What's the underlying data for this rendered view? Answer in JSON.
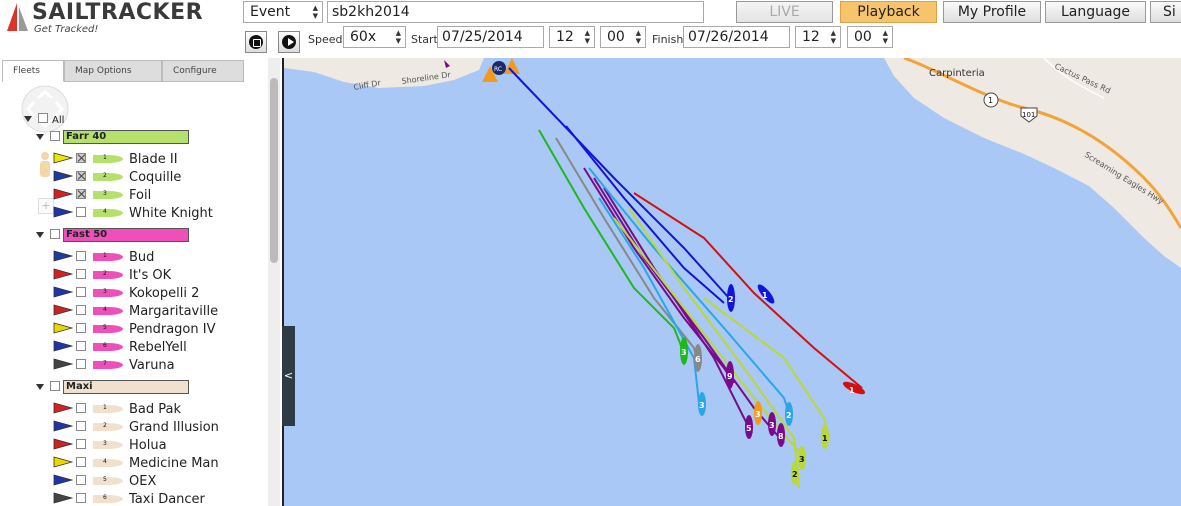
{
  "app": {
    "logo_title": "SAILTRACKER",
    "logo_tagline": "Get Tracked!"
  },
  "header": {
    "mode_select": "Event",
    "event_name": "sb2kh2014",
    "nav": [
      "LIVE",
      "Playback",
      "My Profile",
      "Language",
      "Si"
    ],
    "speed_label": "Speed",
    "speed_value": "60x",
    "start_label": "Start",
    "start_date": "07/25/2014",
    "start_hour": "12",
    "start_min": "00",
    "finish_label": "Finish",
    "finish_date": "07/26/2014",
    "finish_hour": "12",
    "finish_min": "00"
  },
  "tabs": [
    "Fleets",
    "Map Options",
    "Configure"
  ],
  "tree": {
    "all_label": "All",
    "fleets": [
      {
        "name": "Farr 40",
        "color": "#b5e06b",
        "boats": [
          {
            "num": "1",
            "name": "Blade II",
            "checked": true
          },
          {
            "num": "2",
            "name": "Coquille",
            "checked": true
          },
          {
            "num": "3",
            "name": "Foil",
            "checked": true
          },
          {
            "num": "4",
            "name": "White Knight",
            "checked": false
          }
        ]
      },
      {
        "name": "Fast 50",
        "color": "#ee4fb8",
        "boats": [
          {
            "num": "1",
            "name": "Bud",
            "checked": false
          },
          {
            "num": "2",
            "name": "It's OK",
            "checked": false
          },
          {
            "num": "3",
            "name": "Kokopelli 2",
            "checked": false
          },
          {
            "num": "4",
            "name": "Margaritaville",
            "checked": false
          },
          {
            "num": "5",
            "name": "Pendragon IV",
            "checked": false
          },
          {
            "num": "6",
            "name": "RebelYell",
            "checked": false
          },
          {
            "num": "7",
            "name": "Varuna",
            "checked": false
          }
        ]
      },
      {
        "name": "Maxi",
        "color": "#f2e0cf",
        "boats": [
          {
            "num": "1",
            "name": "Bad Pak",
            "checked": false
          },
          {
            "num": "2",
            "name": "Grand Illusion",
            "checked": false
          },
          {
            "num": "3",
            "name": "Holua",
            "checked": false
          },
          {
            "num": "4",
            "name": "Medicine Man",
            "checked": false
          },
          {
            "num": "5",
            "name": "OEX",
            "checked": false
          },
          {
            "num": "6",
            "name": "Taxi Dancer",
            "checked": false
          }
        ]
      }
    ]
  },
  "map": {
    "labels": {
      "cliff": "Cliff Dr",
      "shoreline": "Shoreline Dr",
      "carpinteria": "Carpinteria",
      "cactus": "Cactus Pass Rd",
      "screaming": "Screaming Eagles Hwy",
      "route1": "1",
      "route101": "101",
      "start_mark": "RC"
    },
    "boat_numbers": [
      "1",
      "2",
      "3",
      "6",
      "9",
      "3",
      "2",
      "3",
      "5",
      "8",
      "1",
      "3",
      "2",
      "1",
      "3"
    ],
    "collapse_glyph": "<",
    "colors": {
      "water": "#a9c8f5",
      "land": "#eeeae3",
      "road": "#f2a33a",
      "blue": "#1414d8",
      "red": "#d40f0f",
      "green": "#1eb81e",
      "purple": "#7a0a8a",
      "cyan": "#2aa6e8",
      "lime": "#b9d935",
      "grey": "#888888"
    }
  }
}
